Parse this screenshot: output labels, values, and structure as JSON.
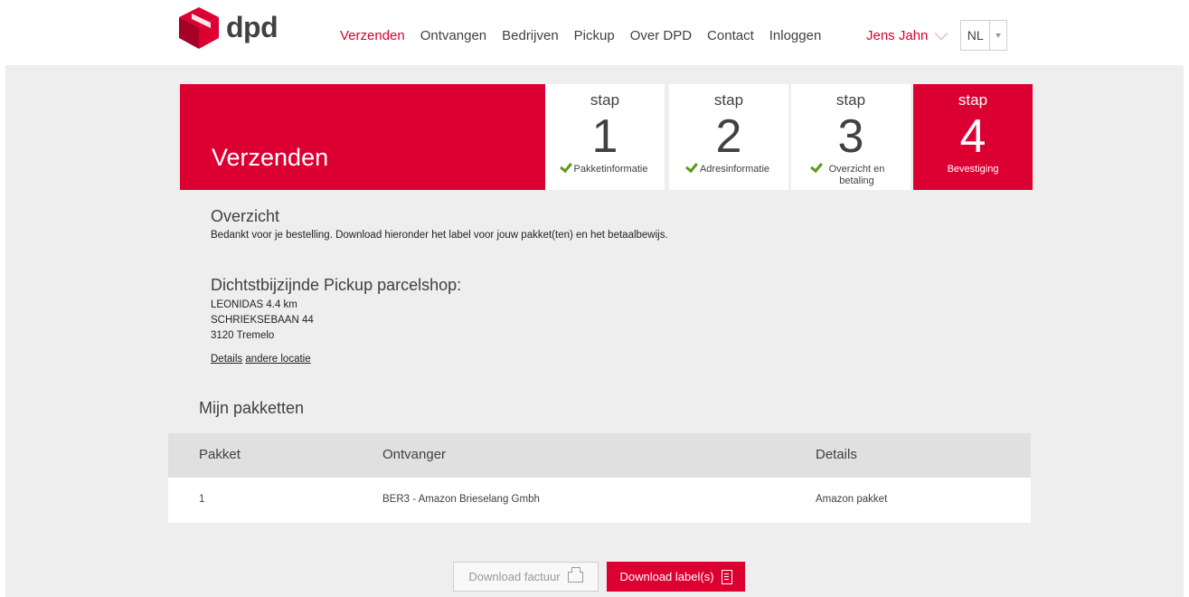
{
  "header": {
    "logo_text": "dpd",
    "nav": [
      "Verzenden",
      "Ontvangen",
      "Bedrijven",
      "Pickup",
      "Over DPD",
      "Contact",
      "Inloggen"
    ],
    "active_nav": "Verzenden",
    "user_name": "Jens Jahn",
    "language": "NL"
  },
  "hero": {
    "title": "Verzenden"
  },
  "steps": [
    {
      "word": "stap",
      "number": "1",
      "label": "Pakketinformatie",
      "completed": true
    },
    {
      "word": "stap",
      "number": "2",
      "label": "Adresinformatie",
      "completed": true
    },
    {
      "word": "stap",
      "number": "3",
      "label": "Overzicht en betaling",
      "completed": true
    },
    {
      "word": "stap",
      "number": "4",
      "label": "Bevestiging",
      "completed": false,
      "active": true
    }
  ],
  "overview": {
    "title": "Overzicht",
    "text": "Bedankt voor je bestelling. Download hieronder het label voor jouw pakket(ten) en het betaalbewijs."
  },
  "pickup": {
    "title": "Dichtstbijzijnde Pickup parcelshop:",
    "name_line": "LEONIDAS 4.4 km",
    "street": "SCHRIEKSEBAAN 44",
    "city": "3120 Tremelo",
    "details_link": "Details",
    "other_link": "andere locatie"
  },
  "packages": {
    "title": "Mijn pakketten",
    "columns": [
      "Pakket",
      "Ontvanger",
      "Details"
    ],
    "rows": [
      {
        "pakket": "1",
        "ontvanger": "BER3 - Amazon Brieselang Gmbh",
        "details": "Amazon pakket"
      }
    ]
  },
  "actions": {
    "download_invoice": "Download factuur",
    "download_labels": "Download label(s)"
  },
  "colors": {
    "brand_red": "#dc0032",
    "check_green": "#5a9a1e",
    "background": "#eeeeee"
  }
}
